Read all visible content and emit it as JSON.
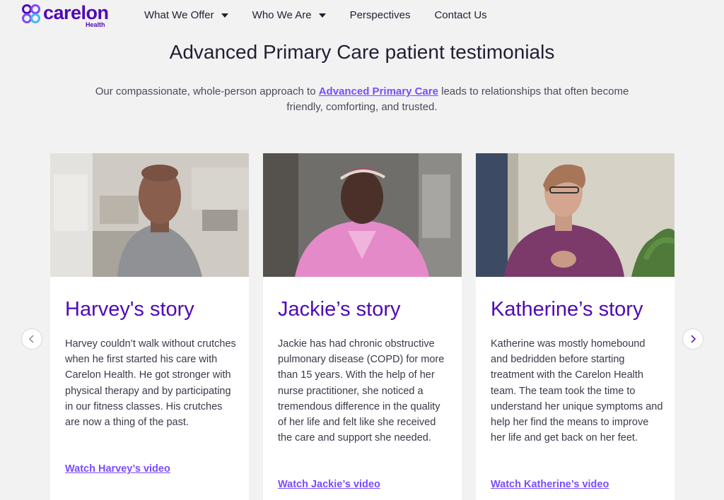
{
  "brand": {
    "name": "carelon",
    "sub": "Health",
    "color": "#5009b5",
    "accent": "#794cff"
  },
  "nav": {
    "items": [
      {
        "label": "What We Offer",
        "dropdown": true
      },
      {
        "label": "Who We Are",
        "dropdown": true
      },
      {
        "label": "Perspectives",
        "dropdown": false
      },
      {
        "label": "Contact Us",
        "dropdown": false
      }
    ]
  },
  "page": {
    "title": "Advanced Primary Care patient testimonials",
    "intro_before": "Our compassionate, whole-person approach to ",
    "intro_link": "Advanced Primary Care",
    "intro_after": " leads to relationships that often become friendly, comforting, and trusted."
  },
  "carousel": {
    "prev_icon": "chevron-left-icon",
    "next_icon": "chevron-right-icon",
    "cards": [
      {
        "title": "Harvey's story",
        "text": "Harvey couldn’t walk without crutches when he first started his care with Carelon Health. He got stronger with physical therapy and by participating in our fitness classes. His crutches are now a thing of the past.",
        "link": "Watch Harvey’s video"
      },
      {
        "title": "Jackie’s story",
        "text": "Jackie has had chronic obstructive pulmonary disease (COPD) for more than 15 years. With the help of her nurse practitioner, she noticed a tremendous difference in the quality of her life and felt like she received the care and support she needed.",
        "link": "Watch Jackie’s video"
      },
      {
        "title": "Katherine’s story",
        "text": "Katherine was mostly homebound and bedridden before starting treatment with the Carelon Health team. The team took the time to understand her unique symptoms and help her find the means to improve her life and get back on her feet.",
        "link": "Watch Katherine’s video"
      }
    ]
  }
}
